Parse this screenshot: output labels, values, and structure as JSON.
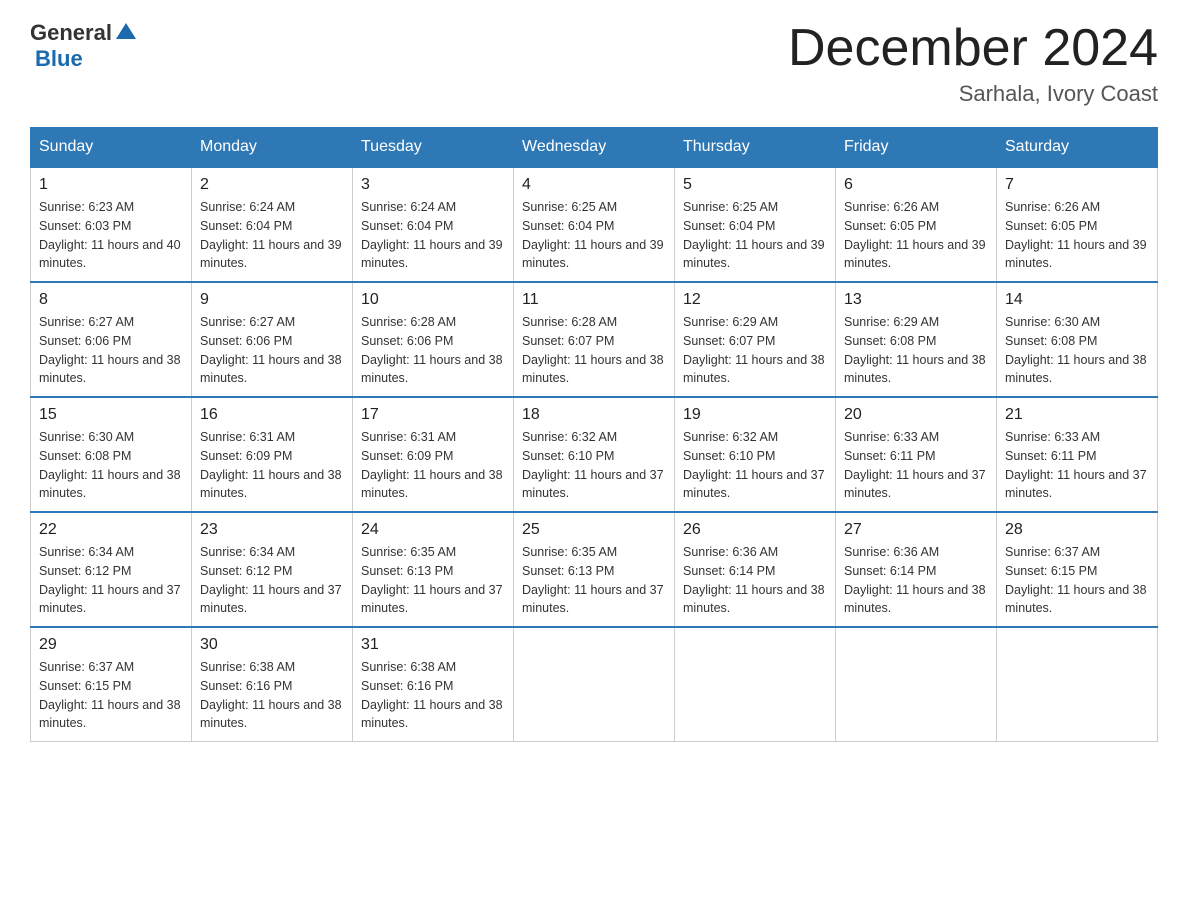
{
  "header": {
    "logo_general": "General",
    "logo_blue": "Blue",
    "month_title": "December 2024",
    "location": "Sarhala, Ivory Coast"
  },
  "days_of_week": [
    "Sunday",
    "Monday",
    "Tuesday",
    "Wednesday",
    "Thursday",
    "Friday",
    "Saturday"
  ],
  "weeks": [
    [
      {
        "day": 1,
        "sunrise": "6:23 AM",
        "sunset": "6:03 PM",
        "daylight": "11 hours and 40 minutes."
      },
      {
        "day": 2,
        "sunrise": "6:24 AM",
        "sunset": "6:04 PM",
        "daylight": "11 hours and 39 minutes."
      },
      {
        "day": 3,
        "sunrise": "6:24 AM",
        "sunset": "6:04 PM",
        "daylight": "11 hours and 39 minutes."
      },
      {
        "day": 4,
        "sunrise": "6:25 AM",
        "sunset": "6:04 PM",
        "daylight": "11 hours and 39 minutes."
      },
      {
        "day": 5,
        "sunrise": "6:25 AM",
        "sunset": "6:04 PM",
        "daylight": "11 hours and 39 minutes."
      },
      {
        "day": 6,
        "sunrise": "6:26 AM",
        "sunset": "6:05 PM",
        "daylight": "11 hours and 39 minutes."
      },
      {
        "day": 7,
        "sunrise": "6:26 AM",
        "sunset": "6:05 PM",
        "daylight": "11 hours and 39 minutes."
      }
    ],
    [
      {
        "day": 8,
        "sunrise": "6:27 AM",
        "sunset": "6:06 PM",
        "daylight": "11 hours and 38 minutes."
      },
      {
        "day": 9,
        "sunrise": "6:27 AM",
        "sunset": "6:06 PM",
        "daylight": "11 hours and 38 minutes."
      },
      {
        "day": 10,
        "sunrise": "6:28 AM",
        "sunset": "6:06 PM",
        "daylight": "11 hours and 38 minutes."
      },
      {
        "day": 11,
        "sunrise": "6:28 AM",
        "sunset": "6:07 PM",
        "daylight": "11 hours and 38 minutes."
      },
      {
        "day": 12,
        "sunrise": "6:29 AM",
        "sunset": "6:07 PM",
        "daylight": "11 hours and 38 minutes."
      },
      {
        "day": 13,
        "sunrise": "6:29 AM",
        "sunset": "6:08 PM",
        "daylight": "11 hours and 38 minutes."
      },
      {
        "day": 14,
        "sunrise": "6:30 AM",
        "sunset": "6:08 PM",
        "daylight": "11 hours and 38 minutes."
      }
    ],
    [
      {
        "day": 15,
        "sunrise": "6:30 AM",
        "sunset": "6:08 PM",
        "daylight": "11 hours and 38 minutes."
      },
      {
        "day": 16,
        "sunrise": "6:31 AM",
        "sunset": "6:09 PM",
        "daylight": "11 hours and 38 minutes."
      },
      {
        "day": 17,
        "sunrise": "6:31 AM",
        "sunset": "6:09 PM",
        "daylight": "11 hours and 38 minutes."
      },
      {
        "day": 18,
        "sunrise": "6:32 AM",
        "sunset": "6:10 PM",
        "daylight": "11 hours and 37 minutes."
      },
      {
        "day": 19,
        "sunrise": "6:32 AM",
        "sunset": "6:10 PM",
        "daylight": "11 hours and 37 minutes."
      },
      {
        "day": 20,
        "sunrise": "6:33 AM",
        "sunset": "6:11 PM",
        "daylight": "11 hours and 37 minutes."
      },
      {
        "day": 21,
        "sunrise": "6:33 AM",
        "sunset": "6:11 PM",
        "daylight": "11 hours and 37 minutes."
      }
    ],
    [
      {
        "day": 22,
        "sunrise": "6:34 AM",
        "sunset": "6:12 PM",
        "daylight": "11 hours and 37 minutes."
      },
      {
        "day": 23,
        "sunrise": "6:34 AM",
        "sunset": "6:12 PM",
        "daylight": "11 hours and 37 minutes."
      },
      {
        "day": 24,
        "sunrise": "6:35 AM",
        "sunset": "6:13 PM",
        "daylight": "11 hours and 37 minutes."
      },
      {
        "day": 25,
        "sunrise": "6:35 AM",
        "sunset": "6:13 PM",
        "daylight": "11 hours and 37 minutes."
      },
      {
        "day": 26,
        "sunrise": "6:36 AM",
        "sunset": "6:14 PM",
        "daylight": "11 hours and 38 minutes."
      },
      {
        "day": 27,
        "sunrise": "6:36 AM",
        "sunset": "6:14 PM",
        "daylight": "11 hours and 38 minutes."
      },
      {
        "day": 28,
        "sunrise": "6:37 AM",
        "sunset": "6:15 PM",
        "daylight": "11 hours and 38 minutes."
      }
    ],
    [
      {
        "day": 29,
        "sunrise": "6:37 AM",
        "sunset": "6:15 PM",
        "daylight": "11 hours and 38 minutes."
      },
      {
        "day": 30,
        "sunrise": "6:38 AM",
        "sunset": "6:16 PM",
        "daylight": "11 hours and 38 minutes."
      },
      {
        "day": 31,
        "sunrise": "6:38 AM",
        "sunset": "6:16 PM",
        "daylight": "11 hours and 38 minutes."
      },
      null,
      null,
      null,
      null
    ]
  ]
}
